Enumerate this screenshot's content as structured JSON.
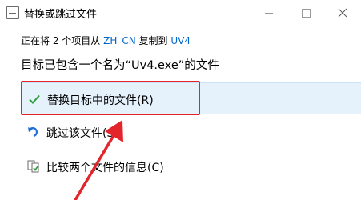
{
  "window": {
    "title": "替换或跳过文件",
    "minimize_icon": "minimize-icon",
    "maximize_icon": "maximize-icon",
    "close_icon": "close-icon"
  },
  "info": {
    "prefix": "正在将 2 个项目从 ",
    "source": "ZH_CN",
    "middle": " 复制到 ",
    "destination": "UV4"
  },
  "heading": "目标已包含一个名为“Uv4.exe”的文件",
  "options": {
    "replace": {
      "label": "替换目标中的文件(R)",
      "icon": "checkmark-icon"
    },
    "skip": {
      "label": "跳过该文件(S)",
      "icon": "skip-icon"
    },
    "compare": {
      "label": "比较两个文件的信息(C)",
      "icon": "compare-files-icon"
    }
  },
  "annotation": {
    "color": "#e3252b"
  },
  "colors": {
    "link": "#0066cc",
    "selected_background": "#e5f1fb",
    "check_green": "#2b9b3a",
    "skip_blue": "#1e6fd6"
  }
}
